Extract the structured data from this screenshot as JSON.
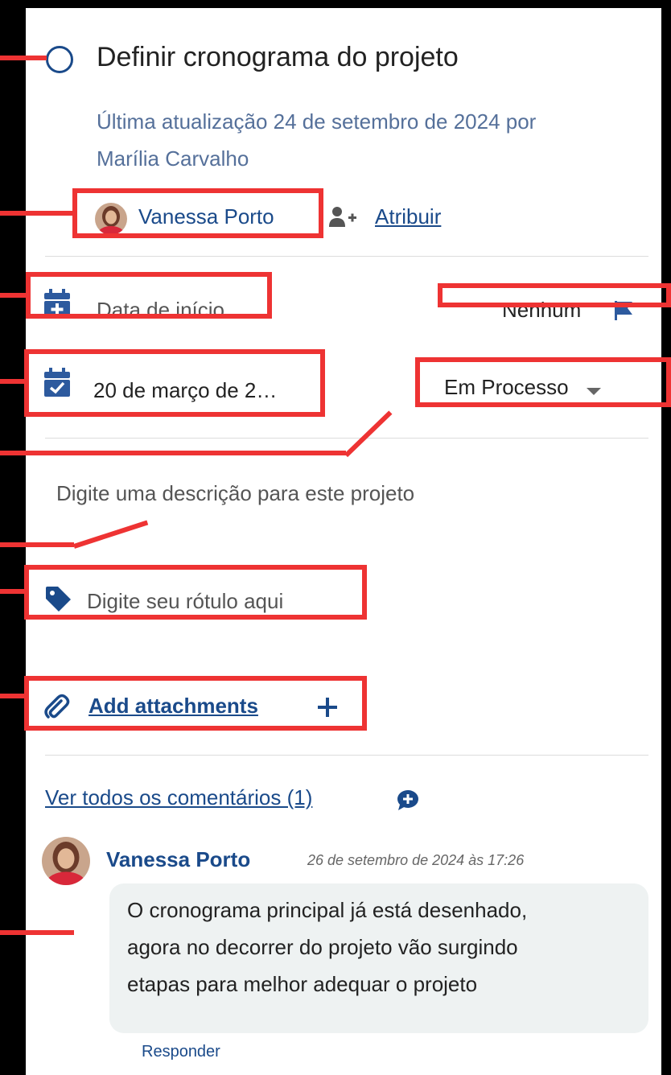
{
  "task": {
    "title": "Definir cronograma do projeto",
    "updated_line1": "Última atualização 24 de setembro de 2024 por",
    "updated_line2": "Marília Carvalho"
  },
  "assignee": {
    "name": "Vanessa Porto",
    "assign_label": "Atribuir"
  },
  "dates": {
    "start_placeholder": "Data de início",
    "due_value": "20 de março de 2…"
  },
  "priority": {
    "value": "Nenhum"
  },
  "status": {
    "value": "Em Processo"
  },
  "description": {
    "placeholder": "Digite uma descrição para este projeto"
  },
  "label": {
    "placeholder": "Digite seu rótulo aqui"
  },
  "attachments": {
    "label": "Add attachments"
  },
  "comments": {
    "view_all": "Ver todos os comentários (1)",
    "items": [
      {
        "author": "Vanessa Porto",
        "timestamp": "26 de setembro de 2024 às 17:26",
        "text_lines": [
          "O cronograma principal já está desenhado,",
          "agora no decorrer do projeto vão surgindo",
          "etapas para melhor adequar o projeto"
        ],
        "reply_label": "Responder"
      }
    ]
  },
  "colors": {
    "accent": "#1a4a8a",
    "icon_blue": "#2d5a9e",
    "annotation_red": "#ee3333",
    "muted_text": "#55709a",
    "comment_bg": "#eef2f2"
  }
}
